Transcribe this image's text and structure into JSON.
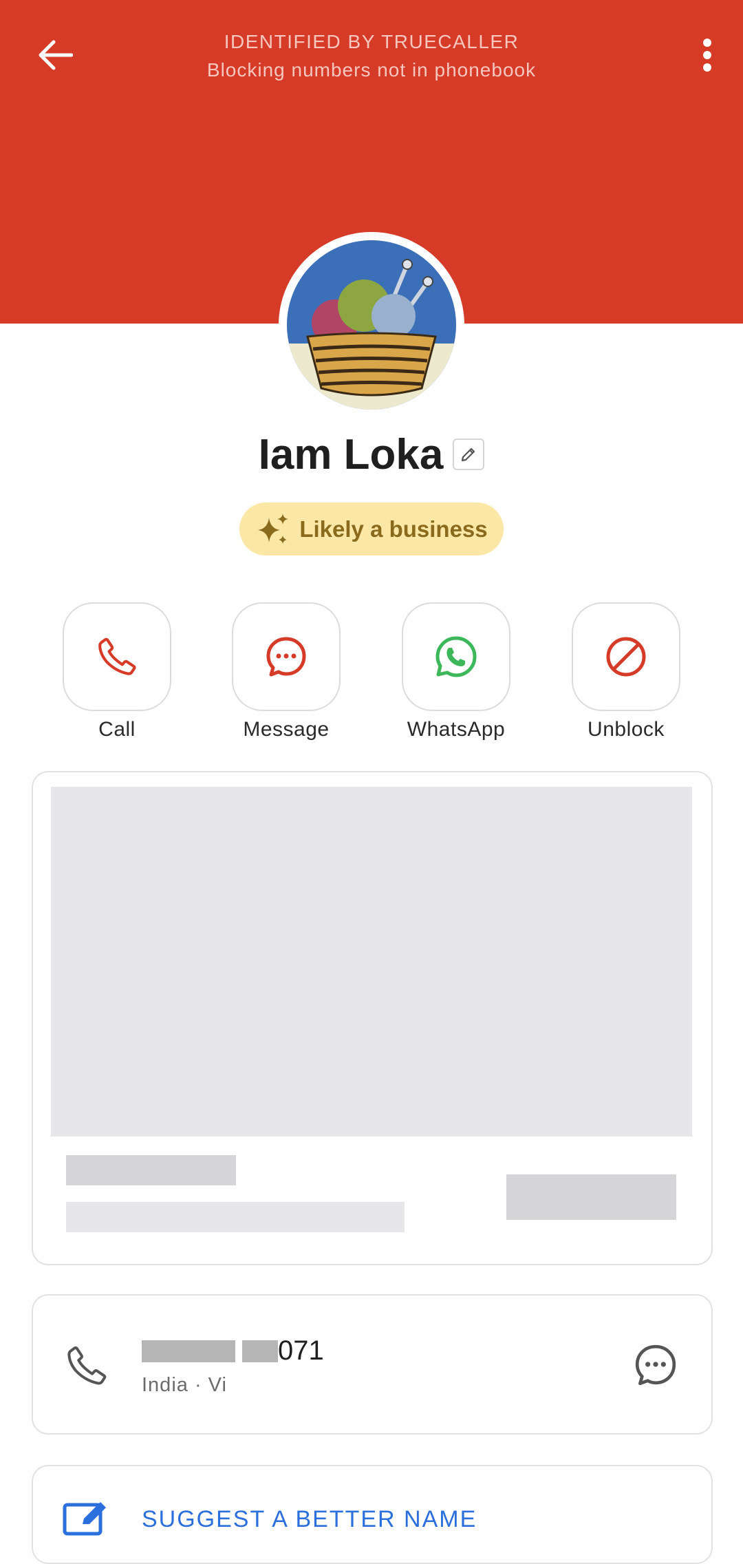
{
  "header": {
    "title": "IDENTIFIED BY TRUECALLER",
    "subtitle": "Blocking numbers not in phonebook",
    "back_icon": "arrow-left-icon",
    "menu_icon": "more-vertical-icon",
    "color": "#d63b28"
  },
  "profile": {
    "name": "Iam Loka",
    "badge": "Likely a business",
    "avatar_desc": "basket-of-yarn-avatar"
  },
  "actions": [
    {
      "label": "Call",
      "icon": "phone-icon",
      "color": "#d63b28"
    },
    {
      "label": "Message",
      "icon": "chat-bubble-icon",
      "color": "#d63b28"
    },
    {
      "label": "WhatsApp",
      "icon": "whatsapp-icon",
      "color": "#3cb85a"
    },
    {
      "label": "Unblock",
      "icon": "block-icon",
      "color": "#d63b28"
    }
  ],
  "phone": {
    "number_suffix": "071",
    "carrier": "India · Vi"
  },
  "suggest": {
    "label": "SUGGEST A BETTER NAME"
  }
}
